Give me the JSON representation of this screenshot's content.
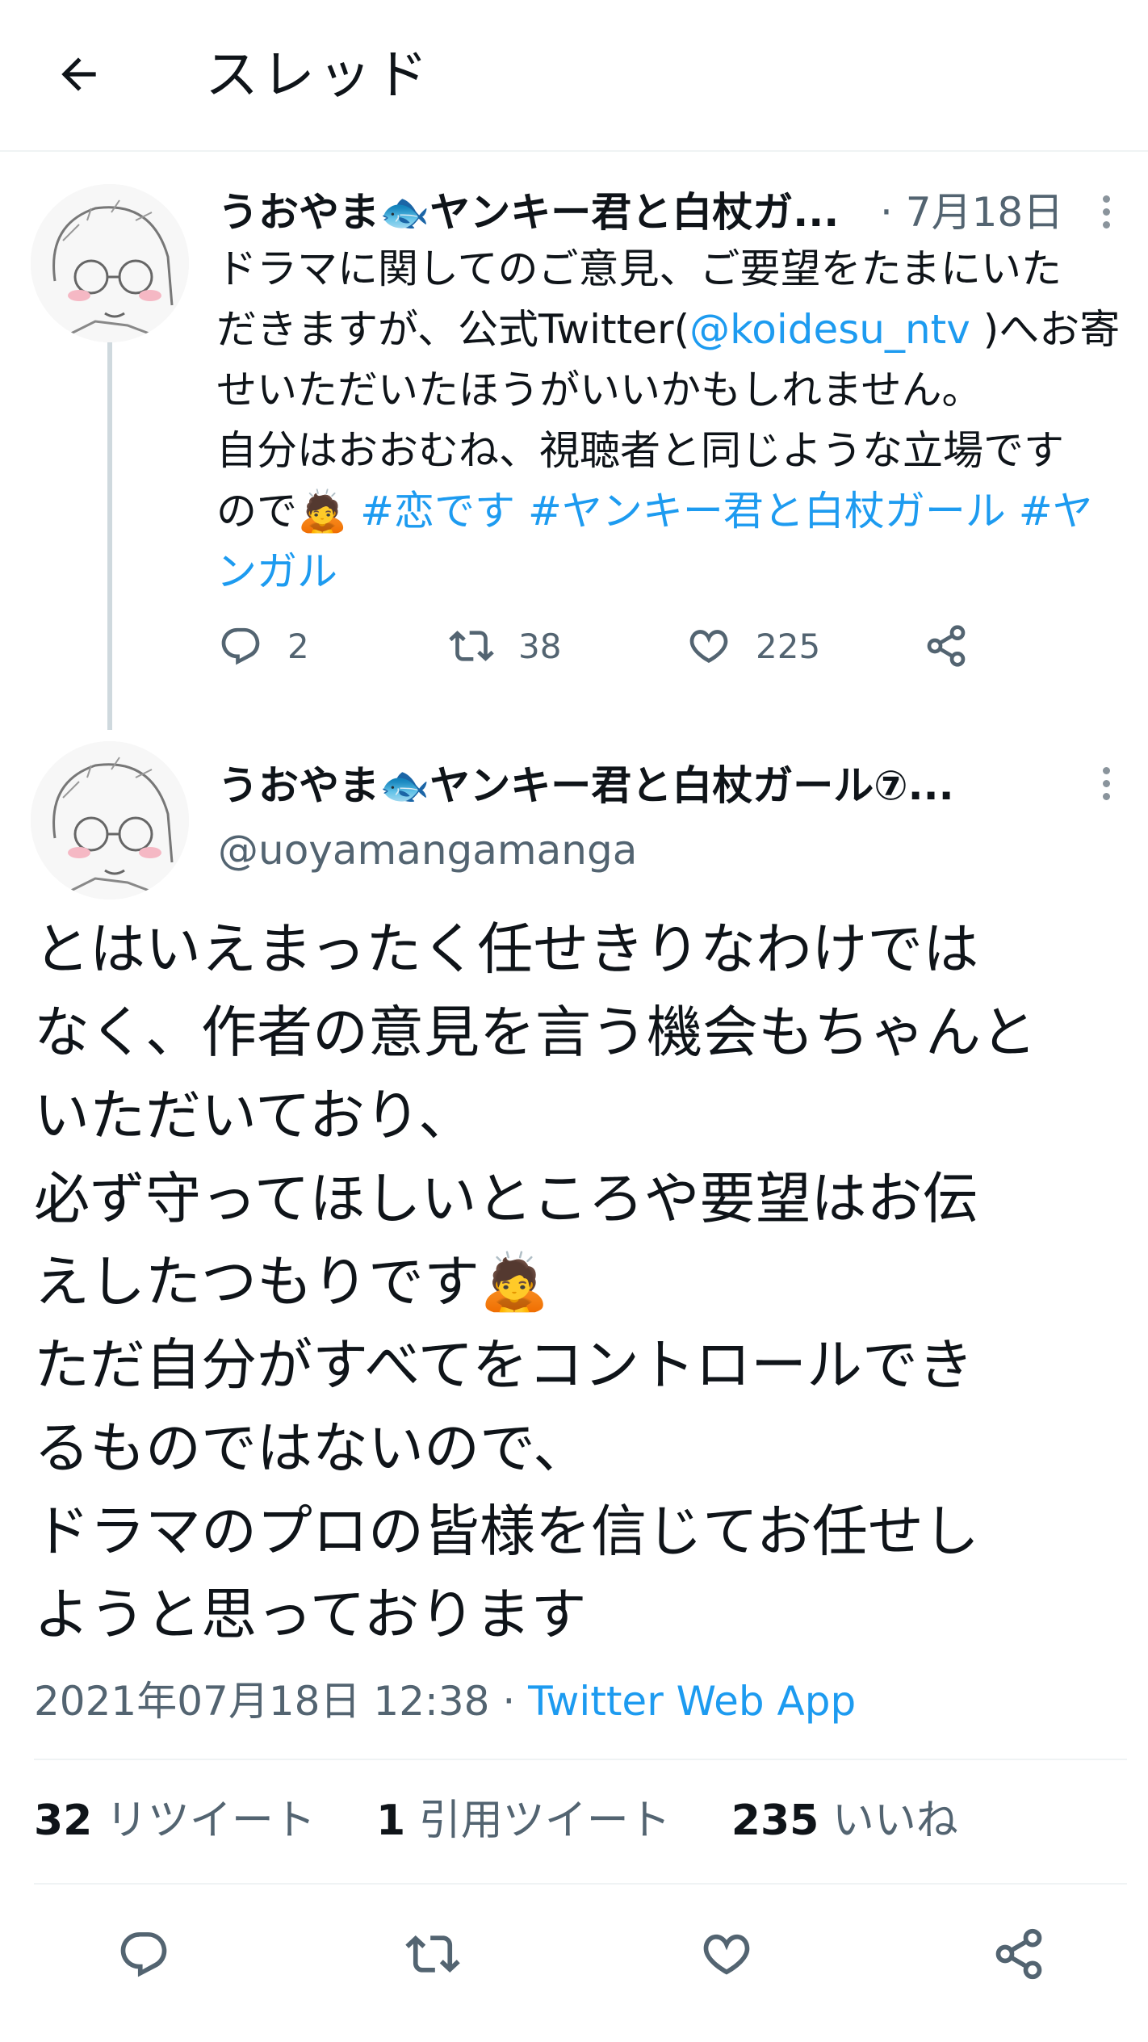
{
  "header": {
    "title": "スレッド"
  },
  "tweet1": {
    "author_name": "うおやま🐟ヤンキー君と白杖ガ...",
    "date": "· 7月18日",
    "lines": [
      {
        "parts": [
          {
            "text": "ドラマに関してのご意見、ご要望をたまにいた"
          }
        ]
      },
      {
        "parts": [
          {
            "text": "だきますが、公式Twitter("
          },
          {
            "text": "@koidesu_ntv",
            "link": true
          },
          {
            "text": " )へお寄"
          }
        ]
      },
      {
        "parts": [
          {
            "text": "せいただいたほうがいいかもしれません。"
          }
        ]
      },
      {
        "parts": [
          {
            "text": "自分はおおむね、視聴者と同じような立場です"
          }
        ]
      },
      {
        "parts": [
          {
            "text": "ので🙇 "
          },
          {
            "text": "#恋です",
            "link": true
          },
          {
            "text": " "
          },
          {
            "text": "#ヤンキー君と白杖ガール",
            "link": true
          },
          {
            "text": " "
          },
          {
            "text": "#ヤ",
            "link": true
          }
        ]
      },
      {
        "parts": [
          {
            "text": "ンガル",
            "link": true
          }
        ]
      }
    ],
    "reply_count": "2",
    "retweet_count": "38",
    "like_count": "225"
  },
  "tweet2": {
    "author_name": "うおやま🐟ヤンキー君と白杖ガール⑦...",
    "handle": "@uoyamangamanga",
    "lines": [
      "とはいえまったく任せきりなわけでは",
      "なく、作者の意見を言う機会もちゃんと",
      "いただいており、",
      "必ず守ってほしいところや要望はお伝",
      "えしたつもりです🙇",
      "ただ自分がすべてをコントロールでき",
      "るものではないので、",
      "ドラマのプロの皆様を信じてお任せし",
      "ようと思っております"
    ],
    "timestamp": "2021年07月18日 12:38 · ",
    "source": "Twitter Web App",
    "retweets": {
      "count": "32",
      "label": "リツイート"
    },
    "quotes": {
      "count": "1",
      "label": "引用ツイート"
    },
    "likes": {
      "count": "235",
      "label": "いいね"
    }
  },
  "colors": {
    "link": "#1d9bf0",
    "secondary_text": "#536471",
    "divider": "#eff3f4"
  },
  "icons": [
    "back-arrow-icon",
    "more-icon",
    "reply-icon",
    "retweet-icon",
    "like-icon",
    "share-icon"
  ]
}
